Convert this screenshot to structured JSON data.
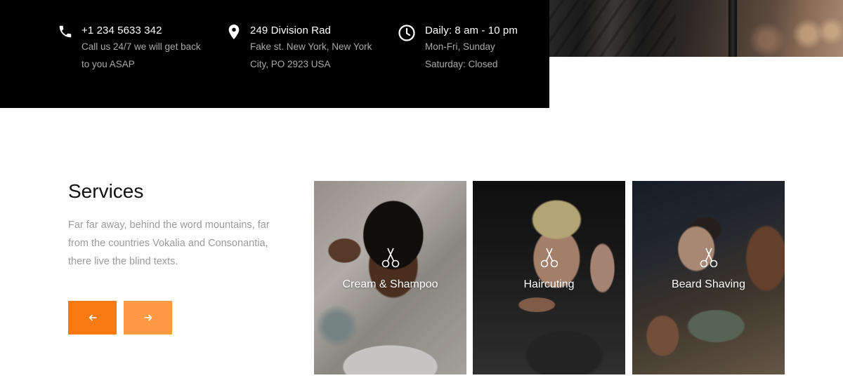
{
  "contact_bar": {
    "phone": {
      "icon": "phone-icon",
      "title": "+1 234 5633 342",
      "line1": "Call us 24/7 we will get back",
      "line2": "to you ASAP"
    },
    "address": {
      "icon": "map-pin-icon",
      "title": "249 Division Rad",
      "line1": "Fake st. New York, New York",
      "line2": "City, PO 2923 USA"
    },
    "hours": {
      "icon": "clock-icon",
      "title": "Daily: 8 am - 10 pm",
      "line1": "Mon-Fri, Sunday",
      "line2": "Saturday: Closed"
    }
  },
  "services": {
    "title": "Services",
    "description": "Far far away, behind the word mountains, far from the countries Vokalia and Consonantia, there live the blind texts.",
    "prev_icon": "arrow-left-icon",
    "next_icon": "arrow-right-icon",
    "cards": [
      {
        "label": "Cream & Shampoo",
        "icon": "scissors-icon"
      },
      {
        "label": "Haircuting",
        "icon": "scissors-icon"
      },
      {
        "label": "Beard Shaving",
        "icon": "scissors-icon"
      }
    ]
  },
  "colors": {
    "info_bar_bg": "#000000",
    "prev_button": "#f97a10",
    "next_button": "#fd9a43"
  }
}
